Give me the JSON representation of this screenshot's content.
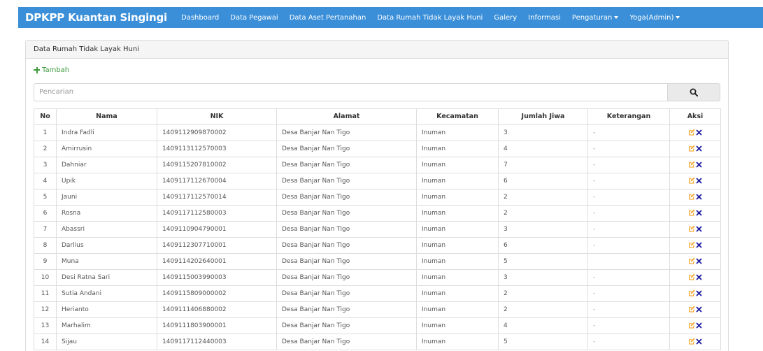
{
  "navbar": {
    "brand": "DPKPP Kuantan Singingi",
    "items": [
      {
        "label": "Dashboard"
      },
      {
        "label": "Data Pegawai"
      },
      {
        "label": "Data Aset Pertanahan"
      },
      {
        "label": "Data Rumah Tidak Layak Huni"
      },
      {
        "label": "Galery"
      },
      {
        "label": "Informasi"
      }
    ],
    "settings_label": "Pengaturan",
    "user_label": "Yoga(Admin)"
  },
  "panel": {
    "heading": "Data Rumah Tidak Layak Huni",
    "add_label": "Tambah",
    "search_placeholder": "Pencarian"
  },
  "table": {
    "headers": [
      "No",
      "Nama",
      "NIK",
      "Alamat",
      "Kecamatan",
      "Jumlah Jiwa",
      "Keterangan",
      "Aksi"
    ],
    "rows": [
      {
        "no": "1",
        "nama": "Indra Fadli",
        "nik": "1409112909870002",
        "alamat": "Desa Banjar Nan Tigo",
        "kecamatan": "Inuman",
        "jumlah": "3",
        "ket": "-"
      },
      {
        "no": "2",
        "nama": "Amirrusin",
        "nik": "1409113112570003",
        "alamat": "Desa Banjar Nan Tigo",
        "kecamatan": "Inuman",
        "jumlah": "4",
        "ket": "-"
      },
      {
        "no": "3",
        "nama": "Dahniar",
        "nik": "1409115207810002",
        "alamat": "Desa Banjar Nan Tigo",
        "kecamatan": "Inuman",
        "jumlah": "7",
        "ket": "-"
      },
      {
        "no": "4",
        "nama": "Upik",
        "nik": "1409117112670004",
        "alamat": "Desa Banjar Nan Tigo",
        "kecamatan": "Inuman",
        "jumlah": "6",
        "ket": "-"
      },
      {
        "no": "5",
        "nama": "Jauni",
        "nik": "1409117112570014",
        "alamat": "Desa Banjar Nan Tigo",
        "kecamatan": "Inuman",
        "jumlah": "2",
        "ket": "-"
      },
      {
        "no": "6",
        "nama": "Rosna",
        "nik": "1409117112580003",
        "alamat": "Desa Banjar Nan Tigo",
        "kecamatan": "Inuman",
        "jumlah": "2",
        "ket": "-"
      },
      {
        "no": "7",
        "nama": "Abassri",
        "nik": "1409110904790001",
        "alamat": "Desa Banjar Nan Tigo",
        "kecamatan": "Inuman",
        "jumlah": "3",
        "ket": "-"
      },
      {
        "no": "8",
        "nama": "Darlius",
        "nik": "1409112307710001",
        "alamat": "Desa Banjar Nan Tigo",
        "kecamatan": "Inuman",
        "jumlah": "6",
        "ket": "-"
      },
      {
        "no": "9",
        "nama": "Muna",
        "nik": "1409114202640001",
        "alamat": "Desa Banjar Nan Tigo",
        "kecamatan": "Inuman",
        "jumlah": "5",
        "ket": ""
      },
      {
        "no": "10",
        "nama": "Desi Ratna Sari",
        "nik": "1409115003990003",
        "alamat": "Desa Banjar Nan Tigo",
        "kecamatan": "Inuman",
        "jumlah": "3",
        "ket": "-"
      },
      {
        "no": "11",
        "nama": "Sutia Andani",
        "nik": "1409115809000002",
        "alamat": "Desa Banjar Nan Tigo",
        "kecamatan": "Inuman",
        "jumlah": "2",
        "ket": "-"
      },
      {
        "no": "12",
        "nama": "Herianto",
        "nik": "1409111406880002",
        "alamat": "Desa Banjar Nan Tigo",
        "kecamatan": "Inuman",
        "jumlah": "2",
        "ket": "-"
      },
      {
        "no": "13",
        "nama": "Marhalim",
        "nik": "1409111803900001",
        "alamat": "Desa Banjar Nan Tigo",
        "kecamatan": "Inuman",
        "jumlah": "4",
        "ket": "-"
      },
      {
        "no": "14",
        "nama": "Sijau",
        "nik": "1409117112440003",
        "alamat": "Desa Banjar Nan Tigo",
        "kecamatan": "Inuman",
        "jumlah": "5",
        "ket": "-"
      }
    ]
  },
  "icons": {
    "edit": "edit-icon",
    "delete": "delete-icon",
    "search": "search-icon",
    "add": "plus-icon"
  },
  "colors": {
    "navbar": "#3a8fd8",
    "add_link": "#3c9a3c",
    "edit_icon": "#f39c12",
    "delete_icon": "#1a1a9e"
  }
}
